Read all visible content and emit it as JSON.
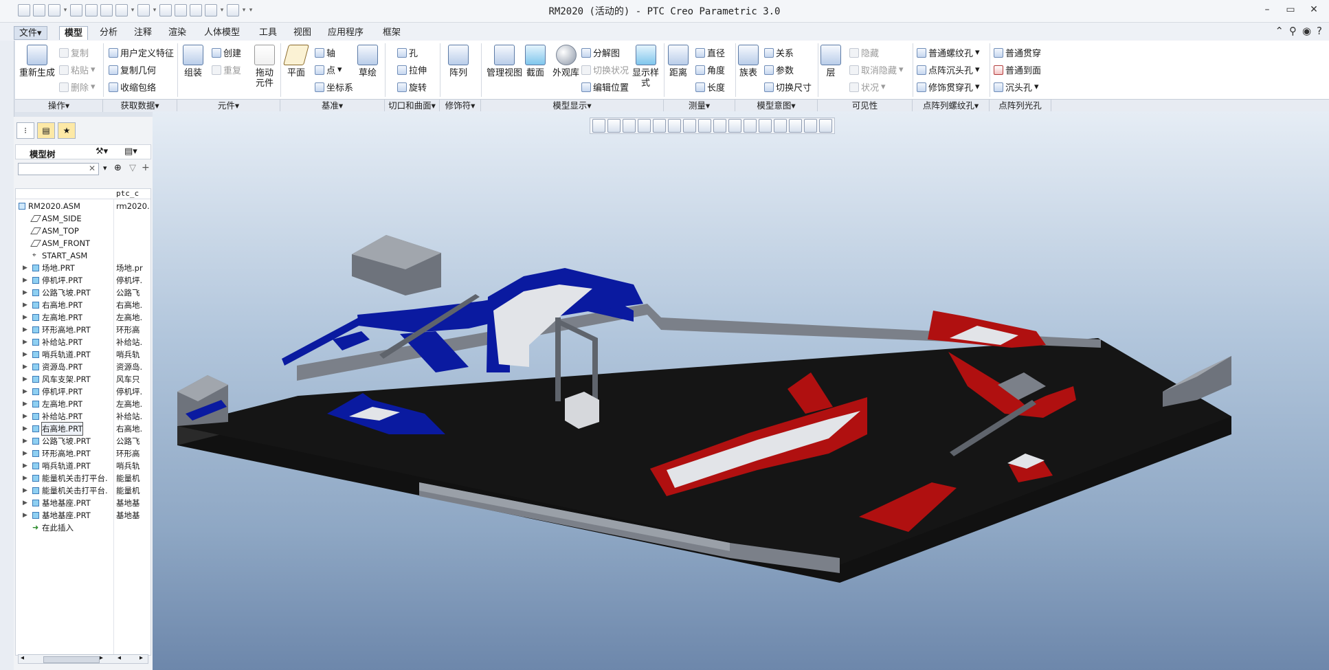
{
  "window": {
    "title": "RM2020 (活动的) - PTC Creo Parametric 3.0",
    "controls": [
      "–",
      "▭",
      "✕"
    ]
  },
  "ribbon_tabs": [
    {
      "label": "文件▾"
    },
    {
      "label": "模型"
    },
    {
      "label": "分析"
    },
    {
      "label": "注释"
    },
    {
      "label": "渲染"
    },
    {
      "label": "人体模型"
    },
    {
      "label": "工具"
    },
    {
      "label": "视图"
    },
    {
      "label": "应用程序"
    },
    {
      "label": "框架"
    }
  ],
  "ribbon": {
    "regenerate": "重新生成",
    "copy": "复制",
    "paste": "粘贴",
    "delete": "删除",
    "user_defined_feature": "用户定义特征",
    "copy_geometry": "复制几何",
    "shrinkwrap": "收缩包络",
    "assemble": "组装",
    "create": "创建",
    "repeat": "重复",
    "drag_components": "拖动\n元件",
    "plane": "平面",
    "axis": "轴",
    "point": "点",
    "csys": "坐标系",
    "sketch": "草绘",
    "hole": "孔",
    "extrude": "拉伸",
    "revolve": "旋转",
    "pattern": "阵列",
    "manage_views": "管理视图",
    "section": "截面",
    "appearance_gallery": "外观库",
    "explode_view": "分解图",
    "toggle_status": "切换状况",
    "edit_position": "编辑位置",
    "display_style": "显示样\n式",
    "distance": "距离",
    "diameter": "直径",
    "angle": "角度",
    "length": "长度",
    "family_table": "族表",
    "relations": "关系",
    "parameters": "参数",
    "switch_dimensions": "切换尺寸",
    "layers": "层",
    "hide": "隐藏",
    "unhide": "取消隐藏",
    "status": "状况",
    "regular_thread": "普通螺纹孔",
    "pattern_countersink": "点阵沉头孔",
    "cosmetic_through": "修饰贯穿孔",
    "regular_through": "普通贯穿",
    "regular_to_face": "普通到面",
    "countersink": "沉头孔"
  },
  "groups": [
    {
      "label": "操作▾"
    },
    {
      "label": "获取数据▾"
    },
    {
      "label": "元件▾"
    },
    {
      "label": "基准▾"
    },
    {
      "label": "切口和曲面▾"
    },
    {
      "label": "修饰符▾"
    },
    {
      "label": "模型显示▾"
    },
    {
      "label": "测量▾"
    },
    {
      "label": "模型意图▾"
    },
    {
      "label": "可见性"
    },
    {
      "label": "点阵列螺纹孔▾"
    },
    {
      "label": "点阵列光孔"
    }
  ],
  "model_tree": {
    "title": "模型树",
    "column_header": "ptc_c",
    "items": [
      {
        "name": "RM2020.ASM",
        "col2": "rm2020.",
        "icon": "asm",
        "expand": false,
        "indent": 0
      },
      {
        "name": "ASM_SIDE",
        "col2": "",
        "icon": "plane",
        "expand": false,
        "indent": 1
      },
      {
        "name": "ASM_TOP",
        "col2": "",
        "icon": "plane",
        "expand": false,
        "indent": 1
      },
      {
        "name": "ASM_FRONT",
        "col2": "",
        "icon": "plane",
        "expand": false,
        "indent": 1
      },
      {
        "name": "START_ASM",
        "col2": "",
        "icon": "csys",
        "expand": false,
        "indent": 1
      },
      {
        "name": "场地.PRT",
        "col2": "场地.pr",
        "icon": "part",
        "expand": true,
        "indent": 1
      },
      {
        "name": "停机坪.PRT",
        "col2": "停机坪.",
        "icon": "part",
        "expand": true,
        "indent": 1
      },
      {
        "name": "公路飞坡.PRT",
        "col2": "公路飞",
        "icon": "part",
        "expand": true,
        "indent": 1
      },
      {
        "name": "右高地.PRT",
        "col2": "右高地.",
        "icon": "part",
        "expand": true,
        "indent": 1
      },
      {
        "name": "左高地.PRT",
        "col2": "左高地.",
        "icon": "part",
        "expand": true,
        "indent": 1
      },
      {
        "name": "环形高地.PRT",
        "col2": "环形高",
        "icon": "part",
        "expand": true,
        "indent": 1
      },
      {
        "name": "补给站.PRT",
        "col2": "补给站.",
        "icon": "part",
        "expand": true,
        "indent": 1
      },
      {
        "name": "哨兵轨道.PRT",
        "col2": "哨兵轨",
        "icon": "part",
        "expand": true,
        "indent": 1
      },
      {
        "name": "资源岛.PRT",
        "col2": "资源岛.",
        "icon": "part",
        "expand": true,
        "indent": 1
      },
      {
        "name": "风车支架.PRT",
        "col2": "风车只",
        "icon": "part",
        "expand": true,
        "indent": 1
      },
      {
        "name": "停机坪.PRT",
        "col2": "停机坪.",
        "icon": "part",
        "expand": true,
        "indent": 1
      },
      {
        "name": "左高地.PRT",
        "col2": "左高地.",
        "icon": "part",
        "expand": true,
        "indent": 1
      },
      {
        "name": "补给站.PRT",
        "col2": "补给站.",
        "icon": "part",
        "expand": true,
        "indent": 1
      },
      {
        "name": "右高地.PRT",
        "col2": "右高地.",
        "icon": "part",
        "expand": true,
        "indent": 1,
        "selected": true
      },
      {
        "name": "公路飞坡.PRT",
        "col2": "公路飞",
        "icon": "part",
        "expand": true,
        "indent": 1
      },
      {
        "name": "环形高地.PRT",
        "col2": "环形高",
        "icon": "part",
        "expand": true,
        "indent": 1
      },
      {
        "name": "哨兵轨道.PRT",
        "col2": "哨兵轨",
        "icon": "part",
        "expand": true,
        "indent": 1
      },
      {
        "name": "能量机关击打平台.",
        "col2": "能量机",
        "icon": "part",
        "expand": true,
        "indent": 1
      },
      {
        "name": "能量机关击打平台.",
        "col2": "能量机",
        "icon": "part",
        "expand": true,
        "indent": 1
      },
      {
        "name": "基地基座.PRT",
        "col2": "基地基",
        "icon": "part",
        "expand": true,
        "indent": 1
      },
      {
        "name": "基地基座.PRT",
        "col2": "基地基",
        "icon": "part",
        "expand": true,
        "indent": 1
      },
      {
        "name": "在此插入",
        "col2": "",
        "icon": "ins",
        "expand": false,
        "indent": 1
      }
    ]
  },
  "colors": {
    "red_team": "#b01010",
    "blue_team": "#0a1aa0",
    "floor": "#151515",
    "walls": "#7b8089"
  }
}
